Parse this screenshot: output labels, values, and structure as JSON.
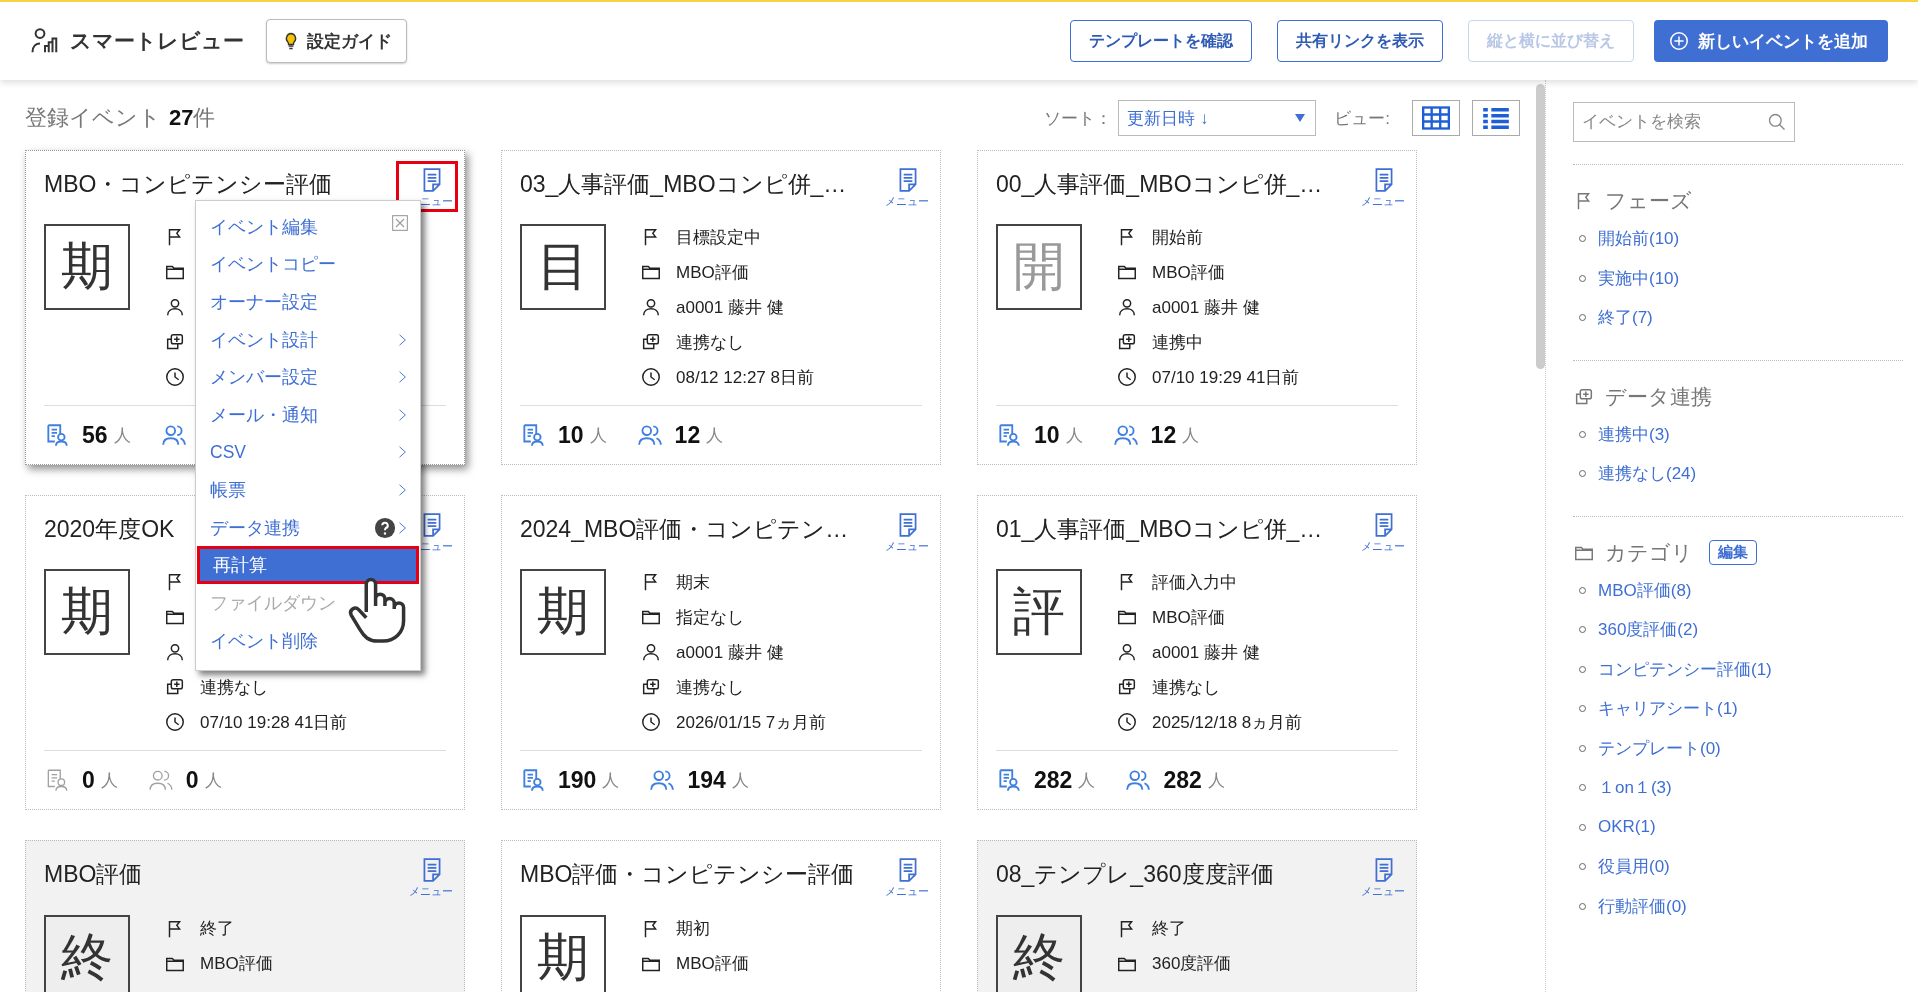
{
  "header": {
    "app_name": "スマートレビュー",
    "guide_button": "設定ガイド",
    "buttons": [
      {
        "label": "テンプレートを確認",
        "disabled": false
      },
      {
        "label": "共有リンクを表示",
        "disabled": false
      },
      {
        "label": "縦と横に並び替え",
        "disabled": true
      }
    ],
    "primary_button": "新しいイベントを追加"
  },
  "toolbar": {
    "count_label": "登録イベント",
    "count": "27",
    "count_unit": "件",
    "sort_label": "ソート：",
    "sort_value": "更新日時 ↓",
    "view_label": "ビュー:",
    "views": [
      {
        "kind": "grid"
      },
      {
        "kind": "list"
      }
    ]
  },
  "cards": [
    {
      "title": "MBO・コンピテンシー評価",
      "menu_label": "ニュー",
      "menu_open": true,
      "ended": false,
      "badge": "期",
      "badge_faded": false,
      "counts_muted": false,
      "meta": [
        {
          "kind": "phase"
        },
        {
          "kind": "category"
        },
        {
          "kind": "owner"
        },
        {
          "kind": "link"
        },
        {
          "kind": "updated"
        }
      ],
      "counts": [
        {
          "kind": "reviewees",
          "value": "56",
          "unit": "人"
        },
        {
          "kind": "reviewers"
        }
      ]
    },
    {
      "title": "03_人事評価_MBOコンピ併_…",
      "menu_label": "メニュー",
      "menu_open": false,
      "ended": false,
      "badge": "目",
      "badge_faded": false,
      "counts_muted": false,
      "meta": [
        {
          "kind": "phase",
          "text": "目標設定中"
        },
        {
          "kind": "category",
          "text": "MBO評価"
        },
        {
          "kind": "owner",
          "text": "a0001 藤井 健"
        },
        {
          "kind": "link",
          "text": "連携なし"
        },
        {
          "kind": "updated",
          "text": "08/12 12:27 8日前"
        }
      ],
      "counts": [
        {
          "kind": "reviewees",
          "value": "10",
          "unit": "人"
        },
        {
          "kind": "reviewers",
          "value": "12",
          "unit": "人"
        }
      ]
    },
    {
      "title": "00_人事評価_MBOコンピ併_…",
      "menu_label": "メニュー",
      "menu_open": false,
      "ended": false,
      "badge": "開",
      "badge_faded": true,
      "counts_muted": false,
      "meta": [
        {
          "kind": "phase",
          "text": "開始前"
        },
        {
          "kind": "category",
          "text": "MBO評価"
        },
        {
          "kind": "owner",
          "text": "a0001 藤井 健"
        },
        {
          "kind": "link",
          "text": "連携中"
        },
        {
          "kind": "updated",
          "text": "07/10 19:29 41日前"
        }
      ],
      "counts": [
        {
          "kind": "reviewees",
          "value": "10",
          "unit": "人"
        },
        {
          "kind": "reviewers",
          "value": "12",
          "unit": "人"
        }
      ]
    },
    {
      "title": "2020年度OK",
      "menu_label": "ニュー",
      "menu_open": false,
      "ended": false,
      "badge": "期",
      "badge_faded": false,
      "counts_muted": true,
      "meta": [
        {
          "kind": "phase"
        },
        {
          "kind": "category"
        },
        {
          "kind": "owner"
        },
        {
          "kind": "link",
          "text": "連携なし"
        },
        {
          "kind": "updated",
          "text": "07/10 19:28 41日前"
        }
      ],
      "counts": [
        {
          "kind": "reviewees",
          "value": "0",
          "unit": "人"
        },
        {
          "kind": "reviewers",
          "value": "0",
          "unit": "人"
        }
      ]
    },
    {
      "title": "2024_MBO評価・コンピテン…",
      "menu_label": "メニュー",
      "menu_open": false,
      "ended": false,
      "badge": "期",
      "badge_faded": false,
      "counts_muted": false,
      "meta": [
        {
          "kind": "phase",
          "text": "期末"
        },
        {
          "kind": "category",
          "text": "指定なし"
        },
        {
          "kind": "owner",
          "text": "a0001 藤井 健"
        },
        {
          "kind": "link",
          "text": "連携なし"
        },
        {
          "kind": "updated",
          "text": "2026/01/15 7ヵ月前"
        }
      ],
      "counts": [
        {
          "kind": "reviewees",
          "value": "190",
          "unit": "人"
        },
        {
          "kind": "reviewers",
          "value": "194",
          "unit": "人"
        }
      ]
    },
    {
      "title": "01_人事評価_MBOコンピ併_…",
      "menu_label": "メニュー",
      "menu_open": false,
      "ended": false,
      "badge": "評",
      "badge_faded": false,
      "counts_muted": false,
      "meta": [
        {
          "kind": "phase",
          "text": "評価入力中"
        },
        {
          "kind": "category",
          "text": "MBO評価"
        },
        {
          "kind": "owner",
          "text": "a0001 藤井 健"
        },
        {
          "kind": "link",
          "text": "連携なし"
        },
        {
          "kind": "updated",
          "text": "2025/12/18 8ヵ月前"
        }
      ],
      "counts": [
        {
          "kind": "reviewees",
          "value": "282",
          "unit": "人"
        },
        {
          "kind": "reviewers",
          "value": "282",
          "unit": "人"
        }
      ]
    },
    {
      "title": "MBO評価",
      "menu_label": "メニュー",
      "menu_open": false,
      "ended": true,
      "badge": "終",
      "badge_faded": false,
      "meta": [
        {
          "kind": "phase",
          "text": "終了"
        },
        {
          "kind": "category",
          "text": "MBO評価"
        }
      ]
    },
    {
      "title": "MBO評価・コンピテンシー評価",
      "menu_label": "メニュー",
      "menu_open": false,
      "ended": false,
      "badge": "期",
      "badge_faded": false,
      "meta": [
        {
          "kind": "phase",
          "text": "期初"
        },
        {
          "kind": "category",
          "text": "MBO評価"
        }
      ]
    },
    {
      "title": "08_テンプレ_360度度評価",
      "menu_label": "メニュー",
      "menu_open": false,
      "ended": true,
      "badge": "終",
      "badge_faded": false,
      "meta": [
        {
          "kind": "phase",
          "text": "終了"
        },
        {
          "kind": "category",
          "text": "360度評価"
        }
      ]
    }
  ],
  "menu": {
    "items": [
      {
        "label": "イベント編集",
        "submenu": false,
        "disabled": false,
        "selected": false
      },
      {
        "label": "イベントコピー",
        "submenu": false,
        "disabled": false,
        "selected": false
      },
      {
        "label": "オーナー設定",
        "submenu": false,
        "disabled": false,
        "selected": false
      },
      {
        "label": "イベント設計",
        "submenu": true,
        "disabled": false,
        "selected": false
      },
      {
        "label": "メンバー設定",
        "submenu": true,
        "disabled": false,
        "selected": false
      },
      {
        "label": "メール・通知",
        "submenu": true,
        "disabled": false,
        "selected": false
      },
      {
        "label": "CSV",
        "submenu": true,
        "disabled": false,
        "selected": false
      },
      {
        "label": "帳票",
        "submenu": true,
        "disabled": false,
        "selected": false
      },
      {
        "label": "データ連携",
        "submenu": true,
        "help": true,
        "disabled": false,
        "selected": false
      },
      {
        "label": "再計算",
        "submenu": false,
        "disabled": false,
        "selected": true
      },
      {
        "label": "ファイルダウン",
        "submenu": false,
        "disabled": true,
        "selected": false
      },
      {
        "label": "イベント削除",
        "submenu": false,
        "disabled": false,
        "selected": false
      }
    ]
  },
  "sidebar": {
    "search_placeholder": "イベントを検索",
    "sections": [
      {
        "kind": "phase",
        "title": "フェーズ",
        "items": [
          "開始前(10)",
          "実施中(10)",
          "終了(7)"
        ]
      },
      {
        "kind": "link",
        "title": "データ連携",
        "items": [
          "連携中(3)",
          "連携なし(24)"
        ]
      },
      {
        "kind": "category",
        "title": "カテゴリ",
        "edit_button": "編集",
        "items": [
          "MBO評価(8)",
          "360度評価(2)",
          "コンピテンシー評価(1)",
          "キャリアシート(1)",
          "テンプレート(0)",
          "１on１(3)",
          "OKR(1)",
          "役員用(0)",
          "行動評価(0)"
        ]
      }
    ]
  }
}
